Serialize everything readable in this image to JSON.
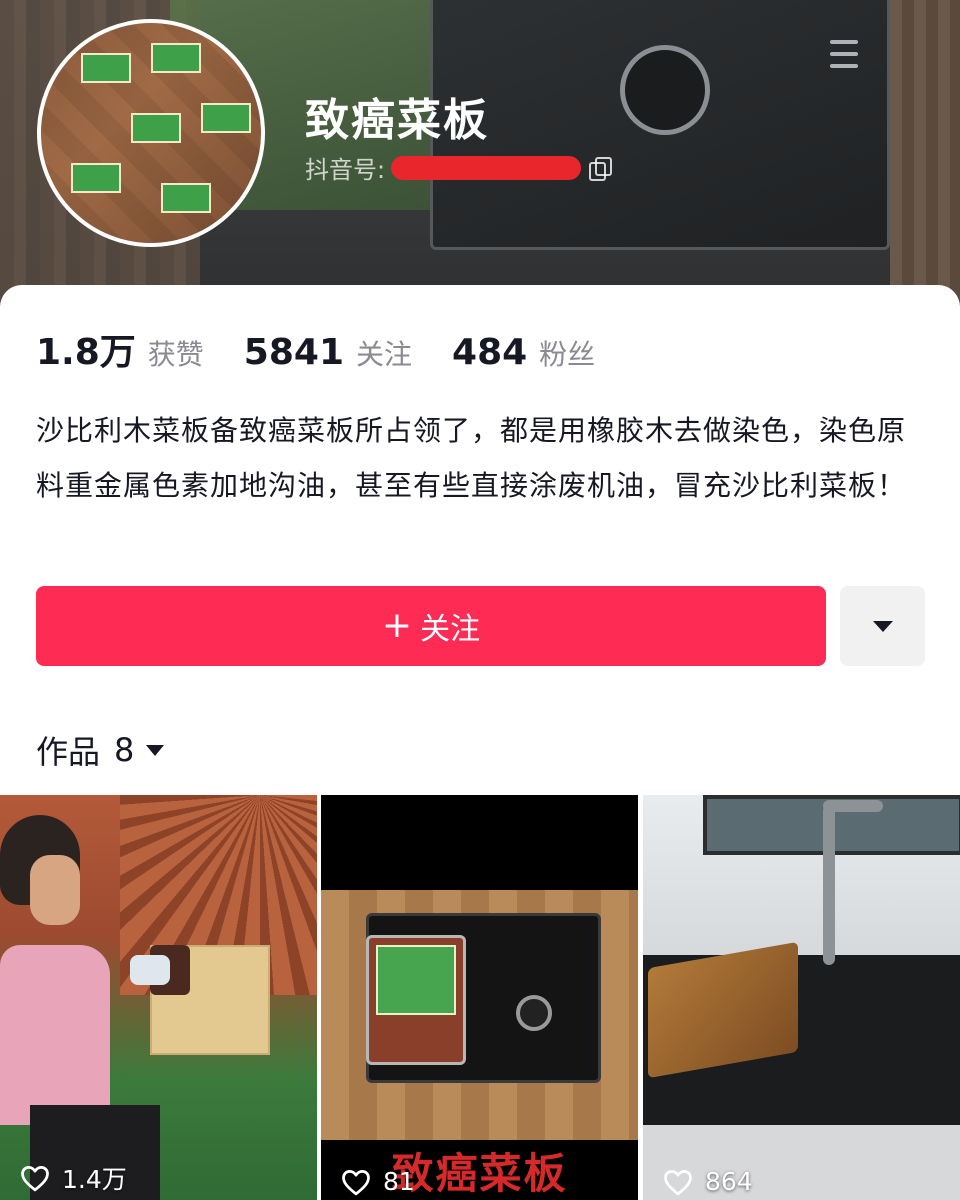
{
  "profile": {
    "name": "致癌菜板",
    "douyin_id_label": "抖音号:",
    "avatar_icon": "avatar-image"
  },
  "stats": [
    {
      "value": "1.8万",
      "label": "获赞"
    },
    {
      "value": "5841",
      "label": "关注"
    },
    {
      "value": "484",
      "label": "粉丝"
    }
  ],
  "bio": "沙比利木菜板备致癌菜板所占领了，都是用橡胶木去做染色，染色原料重金属色素加地沟油，甚至有些直接涂废机油，冒充沙比利菜板！",
  "actions": {
    "follow_plus": "+",
    "follow_label": "关注",
    "more_icon": "caret-down-icon"
  },
  "works": {
    "label": "作品",
    "count": "8"
  },
  "videos": [
    {
      "likes": "1.4万"
    },
    {
      "likes": "81",
      "caption": "致癌菜板"
    },
    {
      "likes": "864"
    }
  ],
  "colors": {
    "accent": "#fe2c55",
    "text": "#161823",
    "muted": "#8a8b91",
    "caption_red": "#d62a2a"
  }
}
